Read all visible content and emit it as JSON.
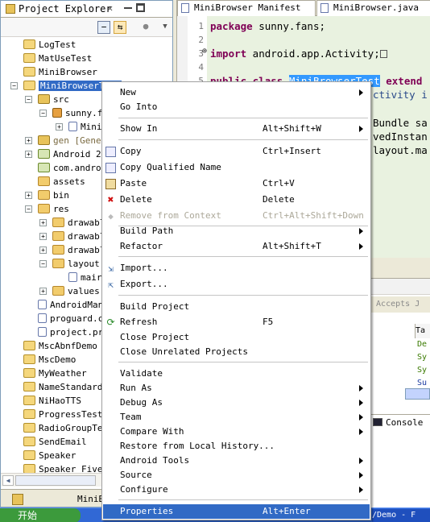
{
  "explorer": {
    "title": "Project Explorer",
    "close_glyph": "✕",
    "status_label": "MiniB",
    "items": [
      {
        "label": "LogTest",
        "icon": "project-icon"
      },
      {
        "label": "MatUseTest",
        "icon": "project-icon"
      },
      {
        "label": "MiniBrowser",
        "icon": "project-icon"
      },
      {
        "label": "MiniBrowserTest",
        "icon": "project-icon",
        "selected": true
      },
      {
        "label": "src",
        "icon": "source-folder-icon"
      },
      {
        "label": "sunny.f",
        "icon": "package-icon"
      },
      {
        "label": "Mini",
        "icon": "java-file-icon"
      },
      {
        "label": "gen [Gener",
        "icon": "source-folder-icon"
      },
      {
        "label": "Android 2.",
        "icon": "library-icon"
      },
      {
        "label": "com.androi",
        "icon": "library-icon"
      },
      {
        "label": "assets",
        "icon": "folder-icon"
      },
      {
        "label": "bin",
        "icon": "folder-icon"
      },
      {
        "label": "res",
        "icon": "folder-icon"
      },
      {
        "label": "drawabl",
        "icon": "folder-icon"
      },
      {
        "label": "drawabl",
        "icon": "folder-icon"
      },
      {
        "label": "drawabl",
        "icon": "folder-icon"
      },
      {
        "label": "layout",
        "icon": "folder-icon"
      },
      {
        "label": "mair",
        "icon": "xml-file-icon"
      },
      {
        "label": "values",
        "icon": "folder-icon"
      },
      {
        "label": "AndroidMan",
        "icon": "xml-file-icon"
      },
      {
        "label": "proguard.c",
        "icon": "file-icon"
      },
      {
        "label": "project.pr",
        "icon": "file-icon"
      },
      {
        "label": "MscAbnfDemo",
        "icon": "project-icon"
      },
      {
        "label": "MscDemo",
        "icon": "project-icon"
      },
      {
        "label": "MyWeather",
        "icon": "project-icon"
      },
      {
        "label": "NameStandard",
        "icon": "project-icon"
      },
      {
        "label": "NiHaoTTS",
        "icon": "project-icon"
      },
      {
        "label": "ProgressTest",
        "icon": "project-icon"
      },
      {
        "label": "RadioGroupTes",
        "icon": "project-icon"
      },
      {
        "label": "SendEmail",
        "icon": "project-icon"
      },
      {
        "label": "Speaker",
        "icon": "project-icon"
      },
      {
        "label": "Speaker Five",
        "icon": "project-icon"
      }
    ]
  },
  "editor": {
    "tabs": [
      {
        "label": "MiniBrowser Manifest",
        "icon": "manifest-icon"
      },
      {
        "label": "MiniBrowser.java",
        "icon": "java-file-icon"
      }
    ],
    "line_numbers": [
      "1",
      "2",
      "3",
      "4",
      "5",
      "6"
    ],
    "code": {
      "l1_kw": "package",
      "l1_rest": " sunny.fans;",
      "l3_kw": "import",
      "l3_rest": " android.app.Activity;",
      "l6_kw": "public class",
      "l6_cls": "MiniBrowserTest",
      "l6_rest": " extend",
      "frag1": "ctivity i",
      "frag2": "Bundle sa",
      "frag3": "vedInstan",
      "frag4": "layout.ma"
    }
  },
  "lower": {
    "hint": ". Accepts J",
    "header": "Ta",
    "cells": [
      "De",
      "Sy",
      "Sy",
      "Su"
    ],
    "console_label": "Console",
    "console_close": "✕"
  },
  "taskbar": {
    "start_label": "开始",
    "task_label": "/Demo - F"
  },
  "context_menu": {
    "items": [
      {
        "label": "New",
        "shortcut": "",
        "submenu": true
      },
      {
        "label": "Go Into",
        "shortcut": "",
        "submenu": false
      },
      {
        "label": "Show In",
        "shortcut": "Alt+Shift+W",
        "submenu": true
      },
      {
        "label": "Copy",
        "shortcut": "Ctrl+Insert",
        "submenu": false,
        "icon": "copy-icon"
      },
      {
        "label": "Copy Qualified Name",
        "shortcut": "",
        "submenu": false,
        "icon": "copy-icon"
      },
      {
        "label": "Paste",
        "shortcut": "Ctrl+V",
        "submenu": false,
        "icon": "paste-icon"
      },
      {
        "label": "Delete",
        "shortcut": "Delete",
        "submenu": false,
        "icon": "delete-icon"
      },
      {
        "label": "Remove from Context",
        "shortcut": "Ctrl+Alt+Shift+Down",
        "submenu": false,
        "disabled": true,
        "icon": "remove-context-icon"
      },
      {
        "label": "Build Path",
        "shortcut": "",
        "submenu": true
      },
      {
        "label": "Refactor",
        "shortcut": "Alt+Shift+T",
        "submenu": true
      },
      {
        "label": "Import...",
        "shortcut": "",
        "submenu": false,
        "icon": "import-icon"
      },
      {
        "label": "Export...",
        "shortcut": "",
        "submenu": false,
        "icon": "export-icon"
      },
      {
        "label": "Build Project",
        "shortcut": "",
        "submenu": false
      },
      {
        "label": "Refresh",
        "shortcut": "F5",
        "submenu": false,
        "icon": "refresh-icon"
      },
      {
        "label": "Close Project",
        "shortcut": "",
        "submenu": false
      },
      {
        "label": "Close Unrelated Projects",
        "shortcut": "",
        "submenu": false
      },
      {
        "label": "Validate",
        "shortcut": "",
        "submenu": false
      },
      {
        "label": "Run As",
        "shortcut": "",
        "submenu": true
      },
      {
        "label": "Debug As",
        "shortcut": "",
        "submenu": true
      },
      {
        "label": "Team",
        "shortcut": "",
        "submenu": true
      },
      {
        "label": "Compare With",
        "shortcut": "",
        "submenu": true
      },
      {
        "label": "Restore from Local History...",
        "shortcut": "",
        "submenu": false
      },
      {
        "label": "Android Tools",
        "shortcut": "",
        "submenu": true
      },
      {
        "label": "Source",
        "shortcut": "",
        "submenu": true
      },
      {
        "label": "Configure",
        "shortcut": "",
        "submenu": true
      },
      {
        "label": "Properties",
        "shortcut": "Alt+Enter",
        "submenu": false,
        "highlighted": true
      }
    ]
  }
}
